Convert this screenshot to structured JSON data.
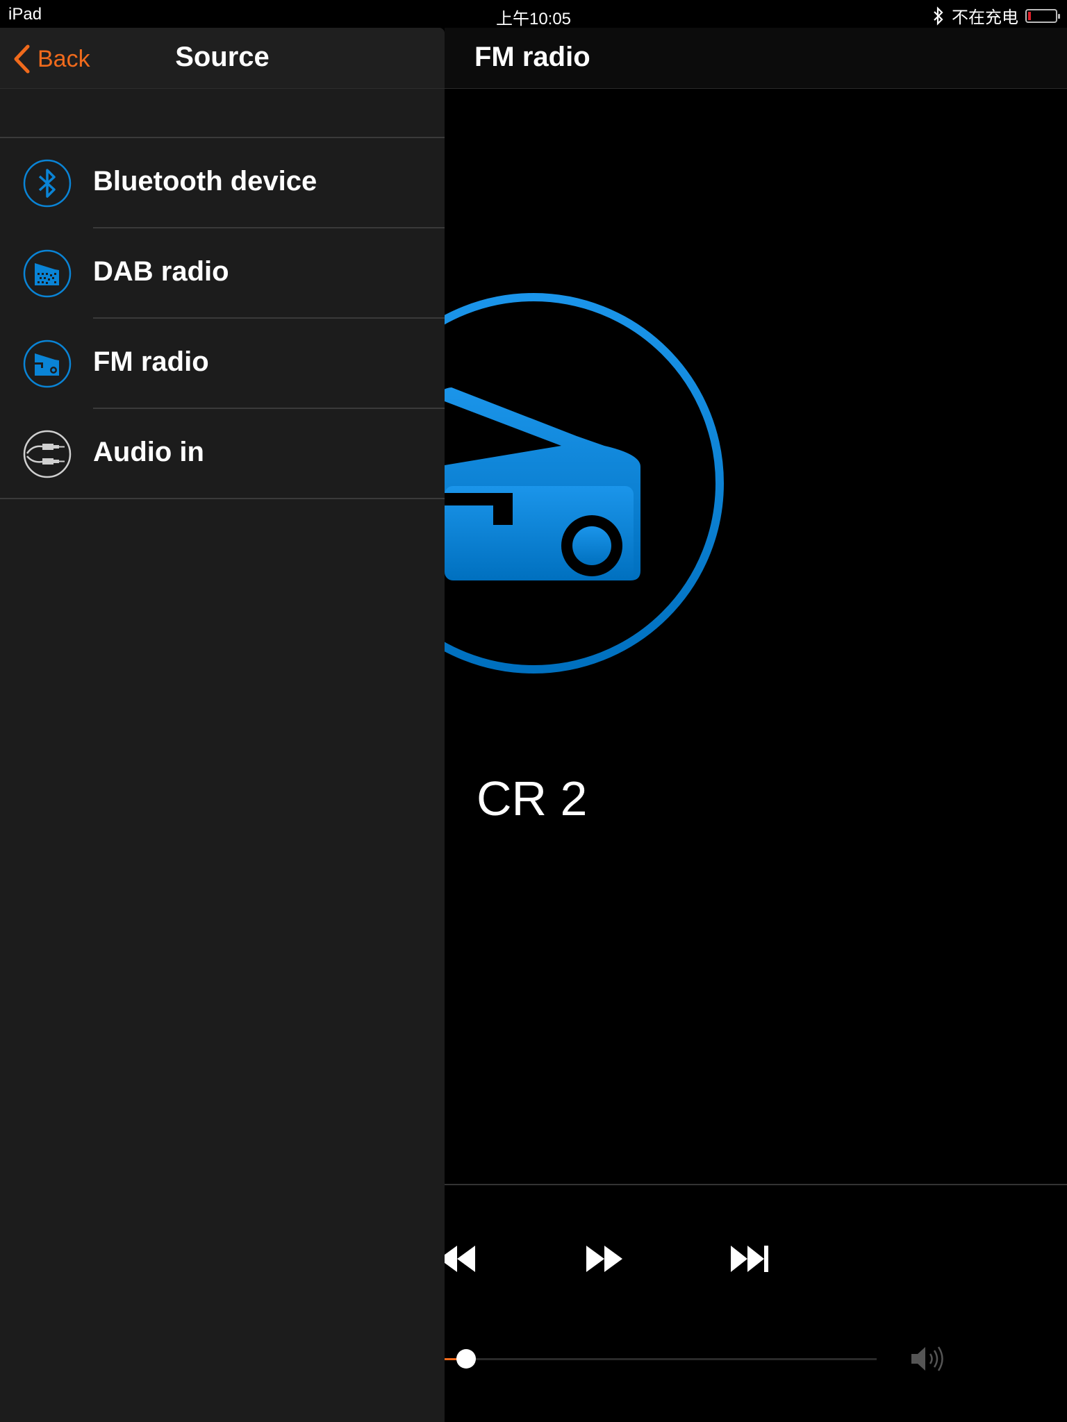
{
  "status_bar": {
    "device": "iPad",
    "time": "上午10:05",
    "charging": "不在充电"
  },
  "source_panel": {
    "back_label": "Back",
    "title": "Source",
    "items": [
      {
        "label": "Bluetooth device",
        "icon": "bluetooth-icon"
      },
      {
        "label": "DAB radio",
        "icon": "dab-radio-icon"
      },
      {
        "label": "FM radio",
        "icon": "fm-radio-icon"
      },
      {
        "label": "Audio in",
        "icon": "audio-in-icon"
      }
    ]
  },
  "player": {
    "title": "FM radio",
    "station": "CR 2",
    "volume_fraction": 0.08
  },
  "colors": {
    "accent": "#f06a1c",
    "icon_blue": "#0a84d6"
  }
}
